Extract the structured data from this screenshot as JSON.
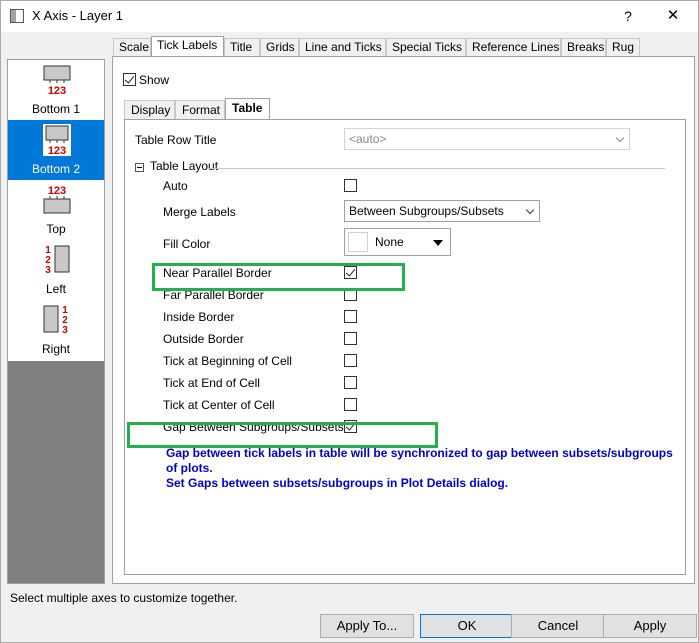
{
  "window": {
    "title": "X Axis - Layer 1",
    "help_label": "?",
    "close_label": "✕"
  },
  "axis_list": {
    "items": [
      {
        "label": "Bottom 1",
        "nums": "123",
        "selected": false
      },
      {
        "label": "Bottom 2",
        "nums": "123",
        "selected": true
      },
      {
        "label": "Top",
        "nums": "123",
        "selected": false
      },
      {
        "label": "Left",
        "nums": "123",
        "selected": false
      },
      {
        "label": "Right",
        "nums": "123",
        "selected": false
      }
    ]
  },
  "category_tabs": [
    "Scale",
    "Tick Labels",
    "Title",
    "Grids",
    "Line and Ticks",
    "Special Ticks",
    "Reference Lines",
    "Breaks",
    "Rug"
  ],
  "active_category": "Tick Labels",
  "show": {
    "label": "Show",
    "checked": true
  },
  "sub_tabs": [
    "Display",
    "Format",
    "Table"
  ],
  "active_sub_tab": "Table",
  "table": {
    "row_title_label": "Table Row Title",
    "row_title_value": "<auto>",
    "layout_section": "Table Layout",
    "auto_label": "Auto",
    "merge_label": "Merge Labels",
    "merge_value": "Between Subgroups/Subsets",
    "fill_label": "Fill Color",
    "fill_value": "None",
    "near_parallel": "Near Parallel Border",
    "far_parallel": "Far Parallel Border",
    "inside_border": "Inside Border",
    "outside_border": "Outside Border",
    "tick_begin": "Tick at Beginning of Cell",
    "tick_end": "Tick at End of Cell",
    "tick_center": "Tick at Center of Cell",
    "gap_label": "Gap Between Subgroups/Subsets",
    "info_line1": "Gap between tick labels in table will be synchronized to gap between subsets/subgroups of plots.",
    "info_line2": "Set Gaps between subsets/subgroups in Plot Details dialog."
  },
  "status_text": "Select multiple axes to customize together.",
  "buttons": {
    "apply_to": "Apply To...",
    "ok": "OK",
    "cancel": "Cancel",
    "apply": "Apply"
  },
  "colors": {
    "selection": "#0078d7",
    "highlight": "#22b14c",
    "info": "#0000cc",
    "axis_glyph_num": "#cc0000"
  }
}
